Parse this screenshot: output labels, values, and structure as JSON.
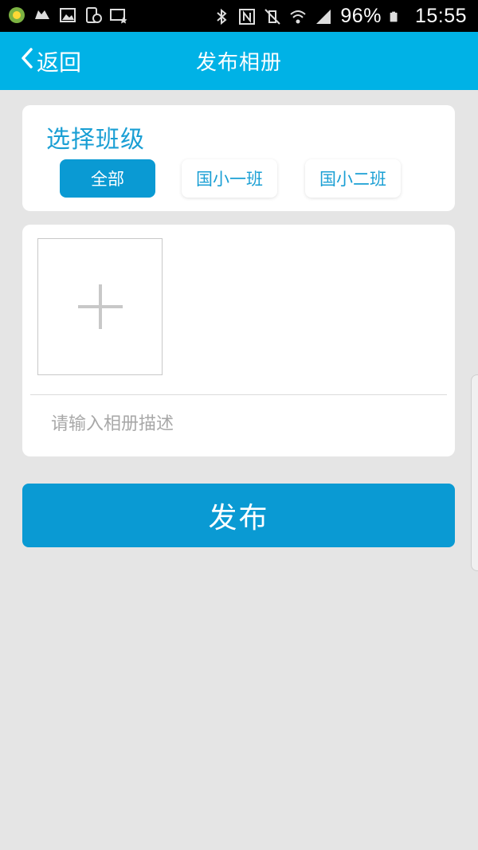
{
  "status_bar": {
    "left_icons": [
      "app-notification-icon",
      "cat-icon",
      "image-icon",
      "device-clock-icon",
      "keyboard-star-icon"
    ],
    "right_icons": [
      "bluetooth-icon",
      "nfc-icon",
      "vibrate-mute-icon",
      "wifi-icon",
      "signal-icon",
      "battery-icon"
    ],
    "battery": "96%",
    "time": "15:55"
  },
  "header": {
    "back_label": "返回",
    "title": "发布相册",
    "color": "#00b2e6"
  },
  "class_select": {
    "heading": "选择班级",
    "options": [
      {
        "label": "全部",
        "selected": true
      },
      {
        "label": "国小一班",
        "selected": false
      },
      {
        "label": "国小二班",
        "selected": false
      }
    ]
  },
  "photo_section": {
    "add_icon": "plus-icon",
    "description_placeholder": "请输入相册描述",
    "description_value": ""
  },
  "publish_button": {
    "label": "发布",
    "color": "#0a9ad3"
  }
}
